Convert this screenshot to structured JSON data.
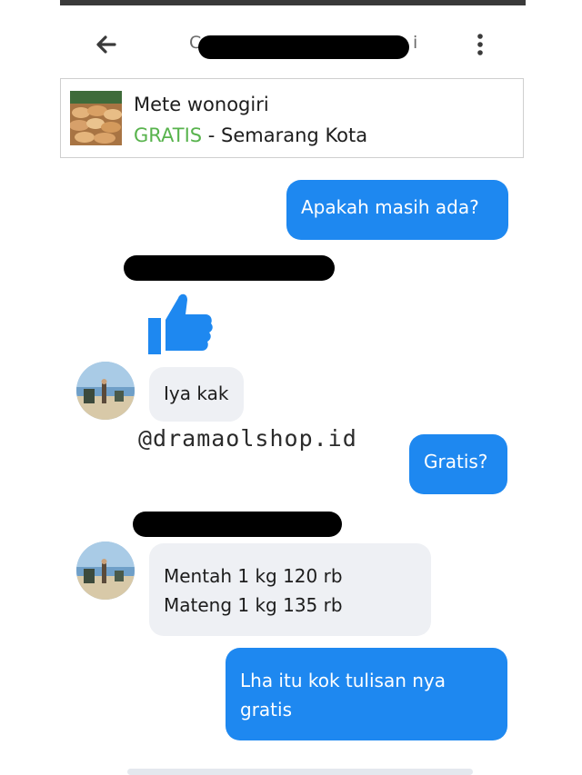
{
  "header": {
    "back_icon": "arrow-left-icon",
    "contact_name_visible_start": "C",
    "contact_name_visible_end": "i",
    "more_icon": "vertical-dots-icon"
  },
  "product": {
    "name": "Mete wonogiri",
    "price": "GRATIS",
    "separator": " - ",
    "location": "Semarang Kota",
    "thumbnail_icon": "cashew-nuts-photo",
    "price_color": "#58b34d"
  },
  "messages": [
    {
      "direction": "outgoing",
      "text": "Apakah masih ada?"
    },
    {
      "direction": "incoming",
      "type": "like",
      "icon": "thumbs-up-icon"
    },
    {
      "direction": "incoming",
      "text": "Iya kak"
    },
    {
      "direction": "outgoing",
      "text": "Gratis?"
    },
    {
      "direction": "incoming",
      "lines": [
        "Mentah 1 kg 120 rb",
        "Mateng 1 kg 135 rb"
      ]
    },
    {
      "direction": "outgoing",
      "lines": [
        "Lha itu kok tulisan nya",
        "gratis"
      ]
    }
  ],
  "watermark": "@dramaolshop.id",
  "colors": {
    "outgoing_bubble": "#1e88f0",
    "incoming_bubble": "#eef0f4",
    "like_icon": "#1e88f0",
    "redaction": "#000000"
  }
}
